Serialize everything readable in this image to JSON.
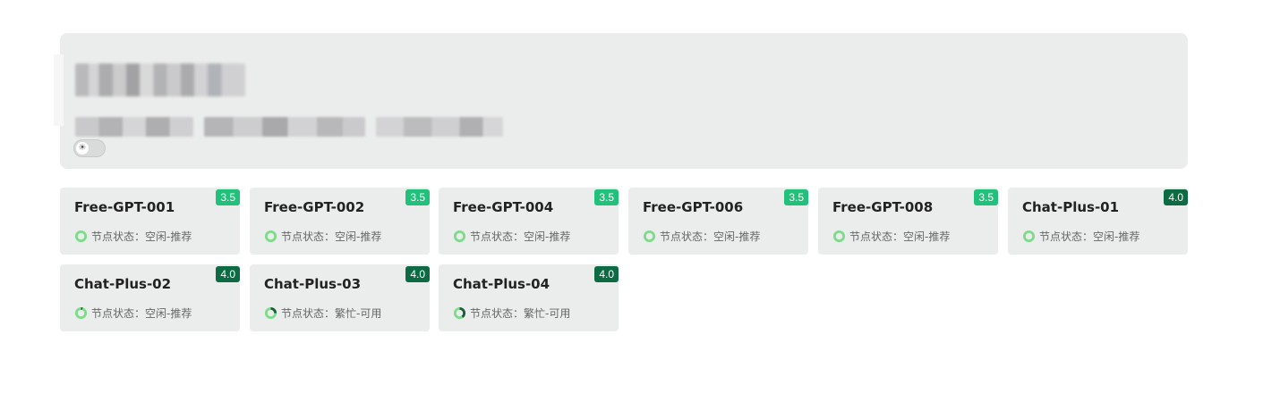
{
  "theme": {
    "badge_colors": {
      "3.5": "#21c17b",
      "4.0": "#0c6b43"
    },
    "status_ring_light": "#7ddb8a",
    "status_ring_dark": "#1c5b3c"
  },
  "header": {
    "toggle_icon": "sun-icon"
  },
  "nodes": [
    {
      "name": "Free-GPT-001",
      "version": "3.5",
      "status_label": "节点状态：空闲-推荐",
      "load": 0
    },
    {
      "name": "Free-GPT-002",
      "version": "3.5",
      "status_label": "节点状态：空闲-推荐",
      "load": 0
    },
    {
      "name": "Free-GPT-004",
      "version": "3.5",
      "status_label": "节点状态：空闲-推荐",
      "load": 0
    },
    {
      "name": "Free-GPT-006",
      "version": "3.5",
      "status_label": "节点状态：空闲-推荐",
      "load": 0
    },
    {
      "name": "Free-GPT-008",
      "version": "3.5",
      "status_label": "节点状态：空闲-推荐",
      "load": 0
    },
    {
      "name": "Chat-Plus-01",
      "version": "4.0",
      "status_label": "节点状态：空闲-推荐",
      "load": 0
    },
    {
      "name": "Chat-Plus-02",
      "version": "4.0",
      "status_label": "节点状态：空闲-推荐",
      "load": 0.05
    },
    {
      "name": "Chat-Plus-03",
      "version": "4.0",
      "status_label": "节点状态：繁忙-可用",
      "load": 0.25
    },
    {
      "name": "Chat-Plus-04",
      "version": "4.0",
      "status_label": "节点状态：繁忙-可用",
      "load": 0.4
    }
  ]
}
